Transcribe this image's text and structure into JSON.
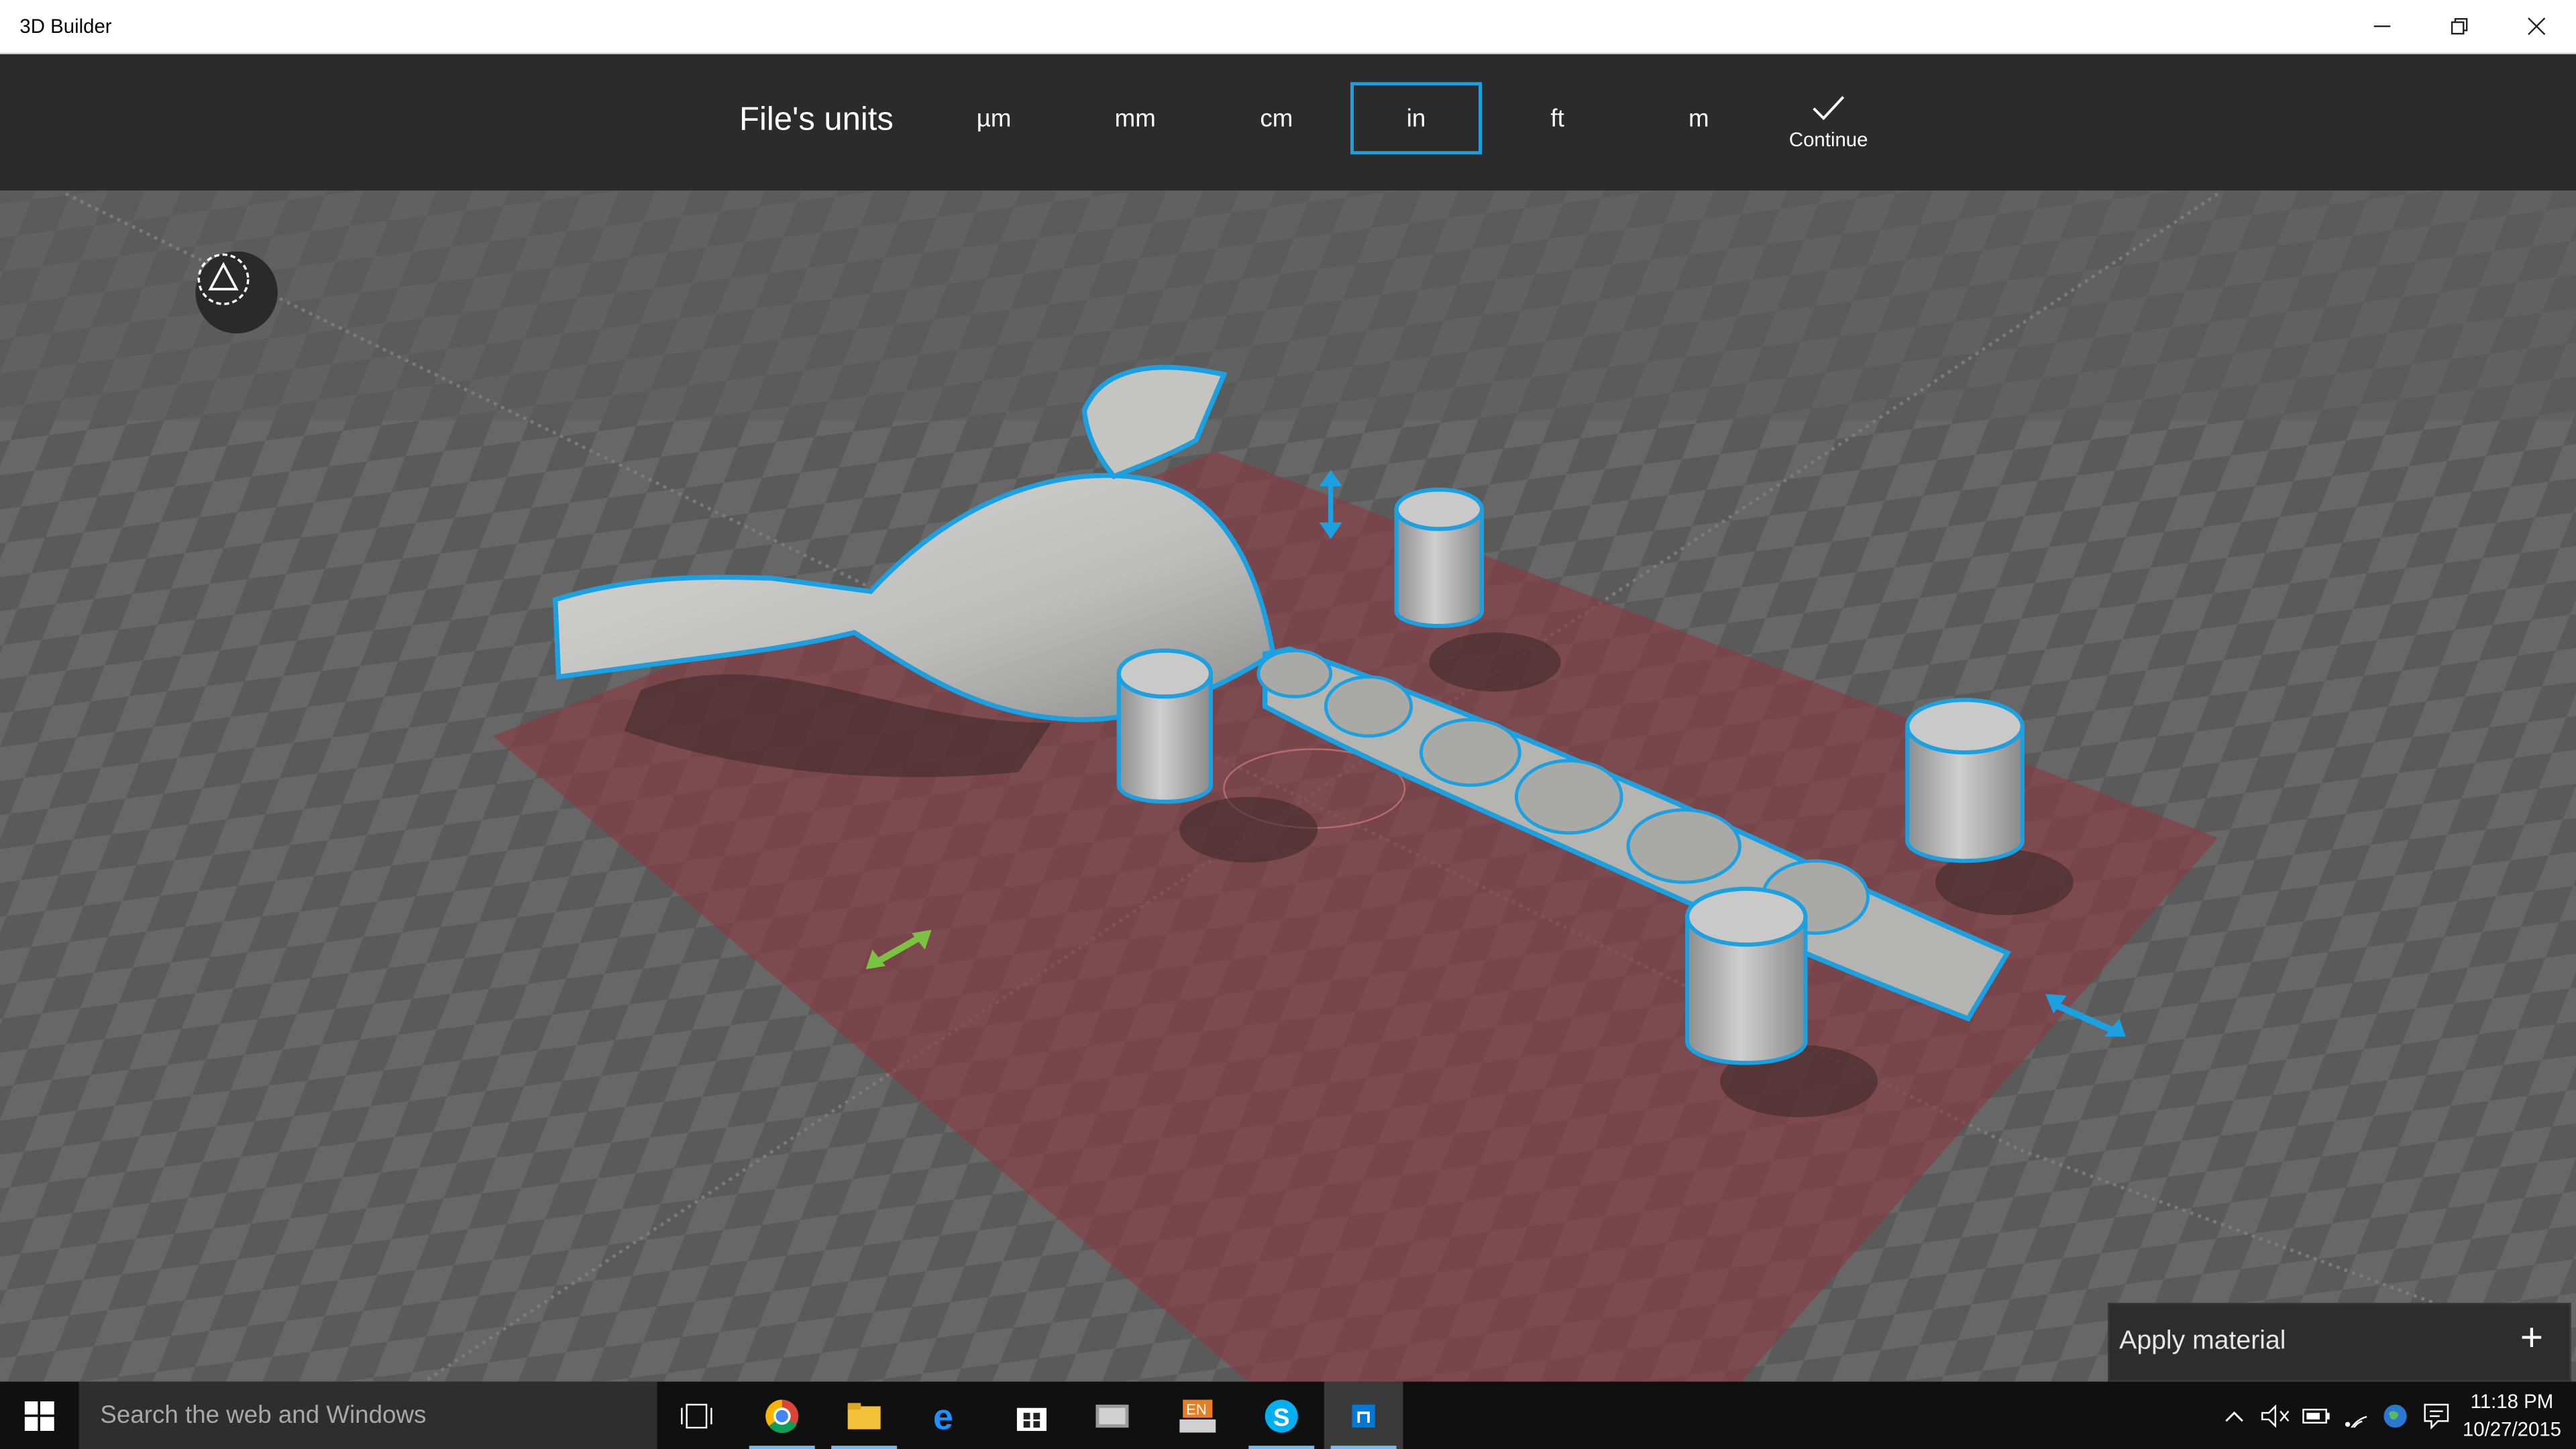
{
  "window": {
    "title": "3D Builder",
    "controls": [
      "minimize",
      "restore",
      "close"
    ]
  },
  "units_bar": {
    "label": "File's units",
    "units": [
      "µm",
      "mm",
      "cm",
      "in",
      "ft",
      "m"
    ],
    "selected": "in",
    "continue_label": "Continue",
    "accent_color": "#1ba1e2"
  },
  "viewport": {
    "scene": "3D model placed on checkered build plate",
    "plate_color": "#8b3a40",
    "outline_color": "#1ba1e2",
    "navigation_icon": "triangle-navigation-icon"
  },
  "apply_material": {
    "label": "Apply material",
    "plus": "+"
  },
  "taskbar": {
    "search_placeholder": "Search the web and Windows",
    "apps": [
      "task-view",
      "chrome",
      "file-explorer",
      "edge",
      "store",
      "photos",
      "language-en",
      "skype",
      "3d-builder"
    ],
    "clock_time": "11:18 PM",
    "clock_date": "10/27/2015"
  }
}
